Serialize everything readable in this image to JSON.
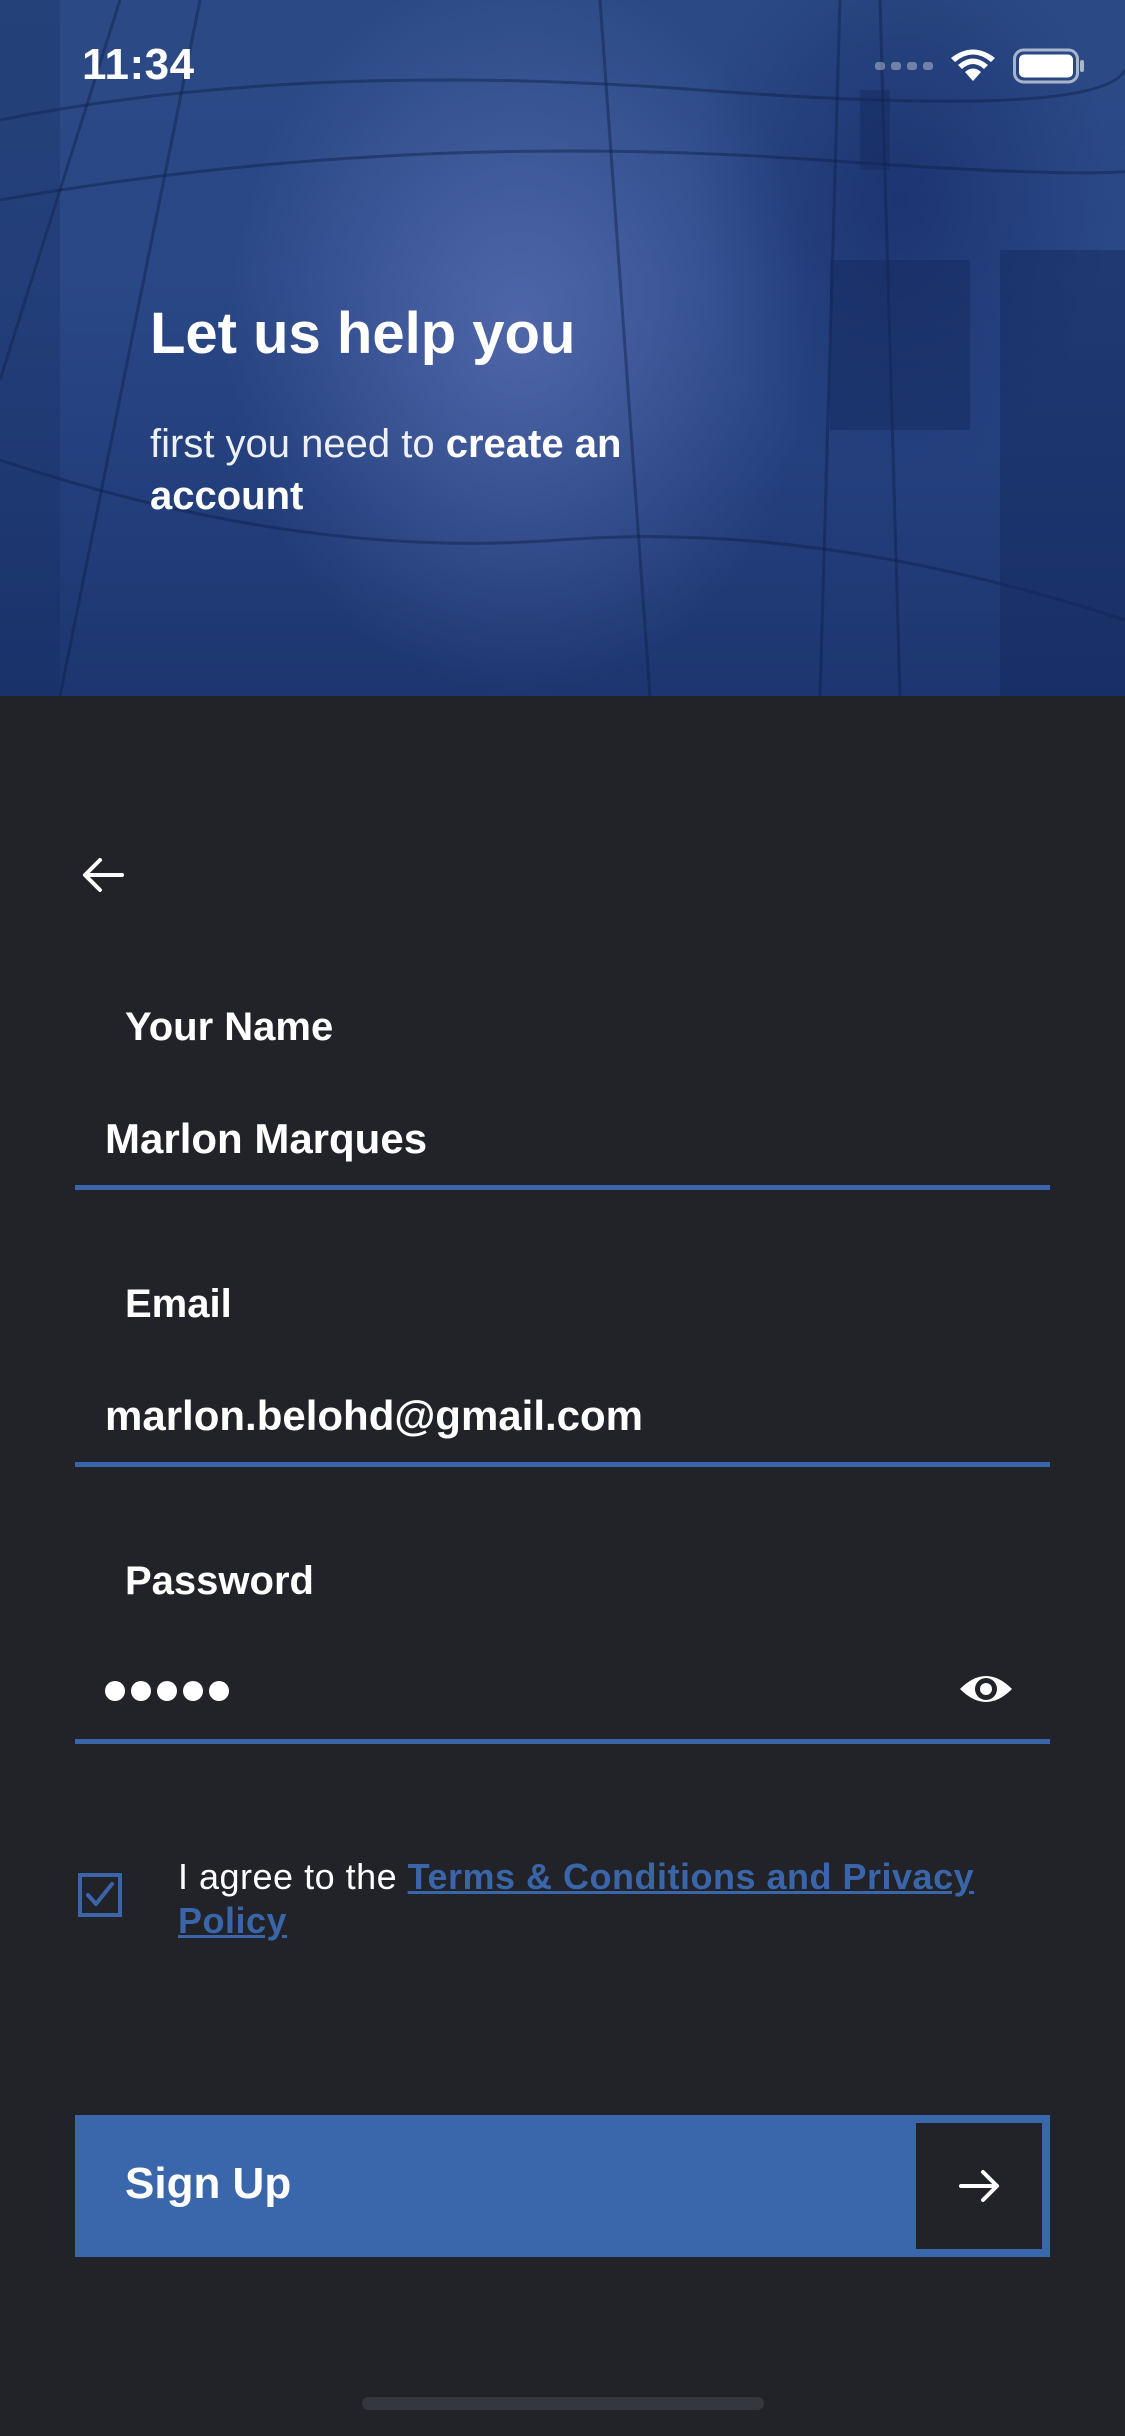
{
  "status_bar": {
    "time": "11:34",
    "icons": [
      "cellular-signal-icon",
      "wifi-icon",
      "battery-icon"
    ]
  },
  "hero": {
    "title": "Let us help you",
    "subtitle_light": "first you need to ",
    "subtitle_bold": "create an account"
  },
  "navigation": {
    "back_icon": "arrow-left-icon"
  },
  "form": {
    "name": {
      "label": "Your Name",
      "value": "Marlon Marques"
    },
    "email": {
      "label": "Email",
      "value": "marlon.belohd@gmail.com"
    },
    "password": {
      "label": "Password",
      "masked_length": 5,
      "visibility_icon": "eye-icon"
    }
  },
  "agreement": {
    "checked": true,
    "text": "I agree to the ",
    "link_text": "Terms & Conditions and Privacy Policy"
  },
  "signup_button": {
    "label": "Sign Up",
    "icon": "arrow-right-icon"
  },
  "colors": {
    "background": "#212329",
    "accent": "#3a67ac",
    "hero_blue": "#2a4786",
    "text": "#ffffff"
  }
}
